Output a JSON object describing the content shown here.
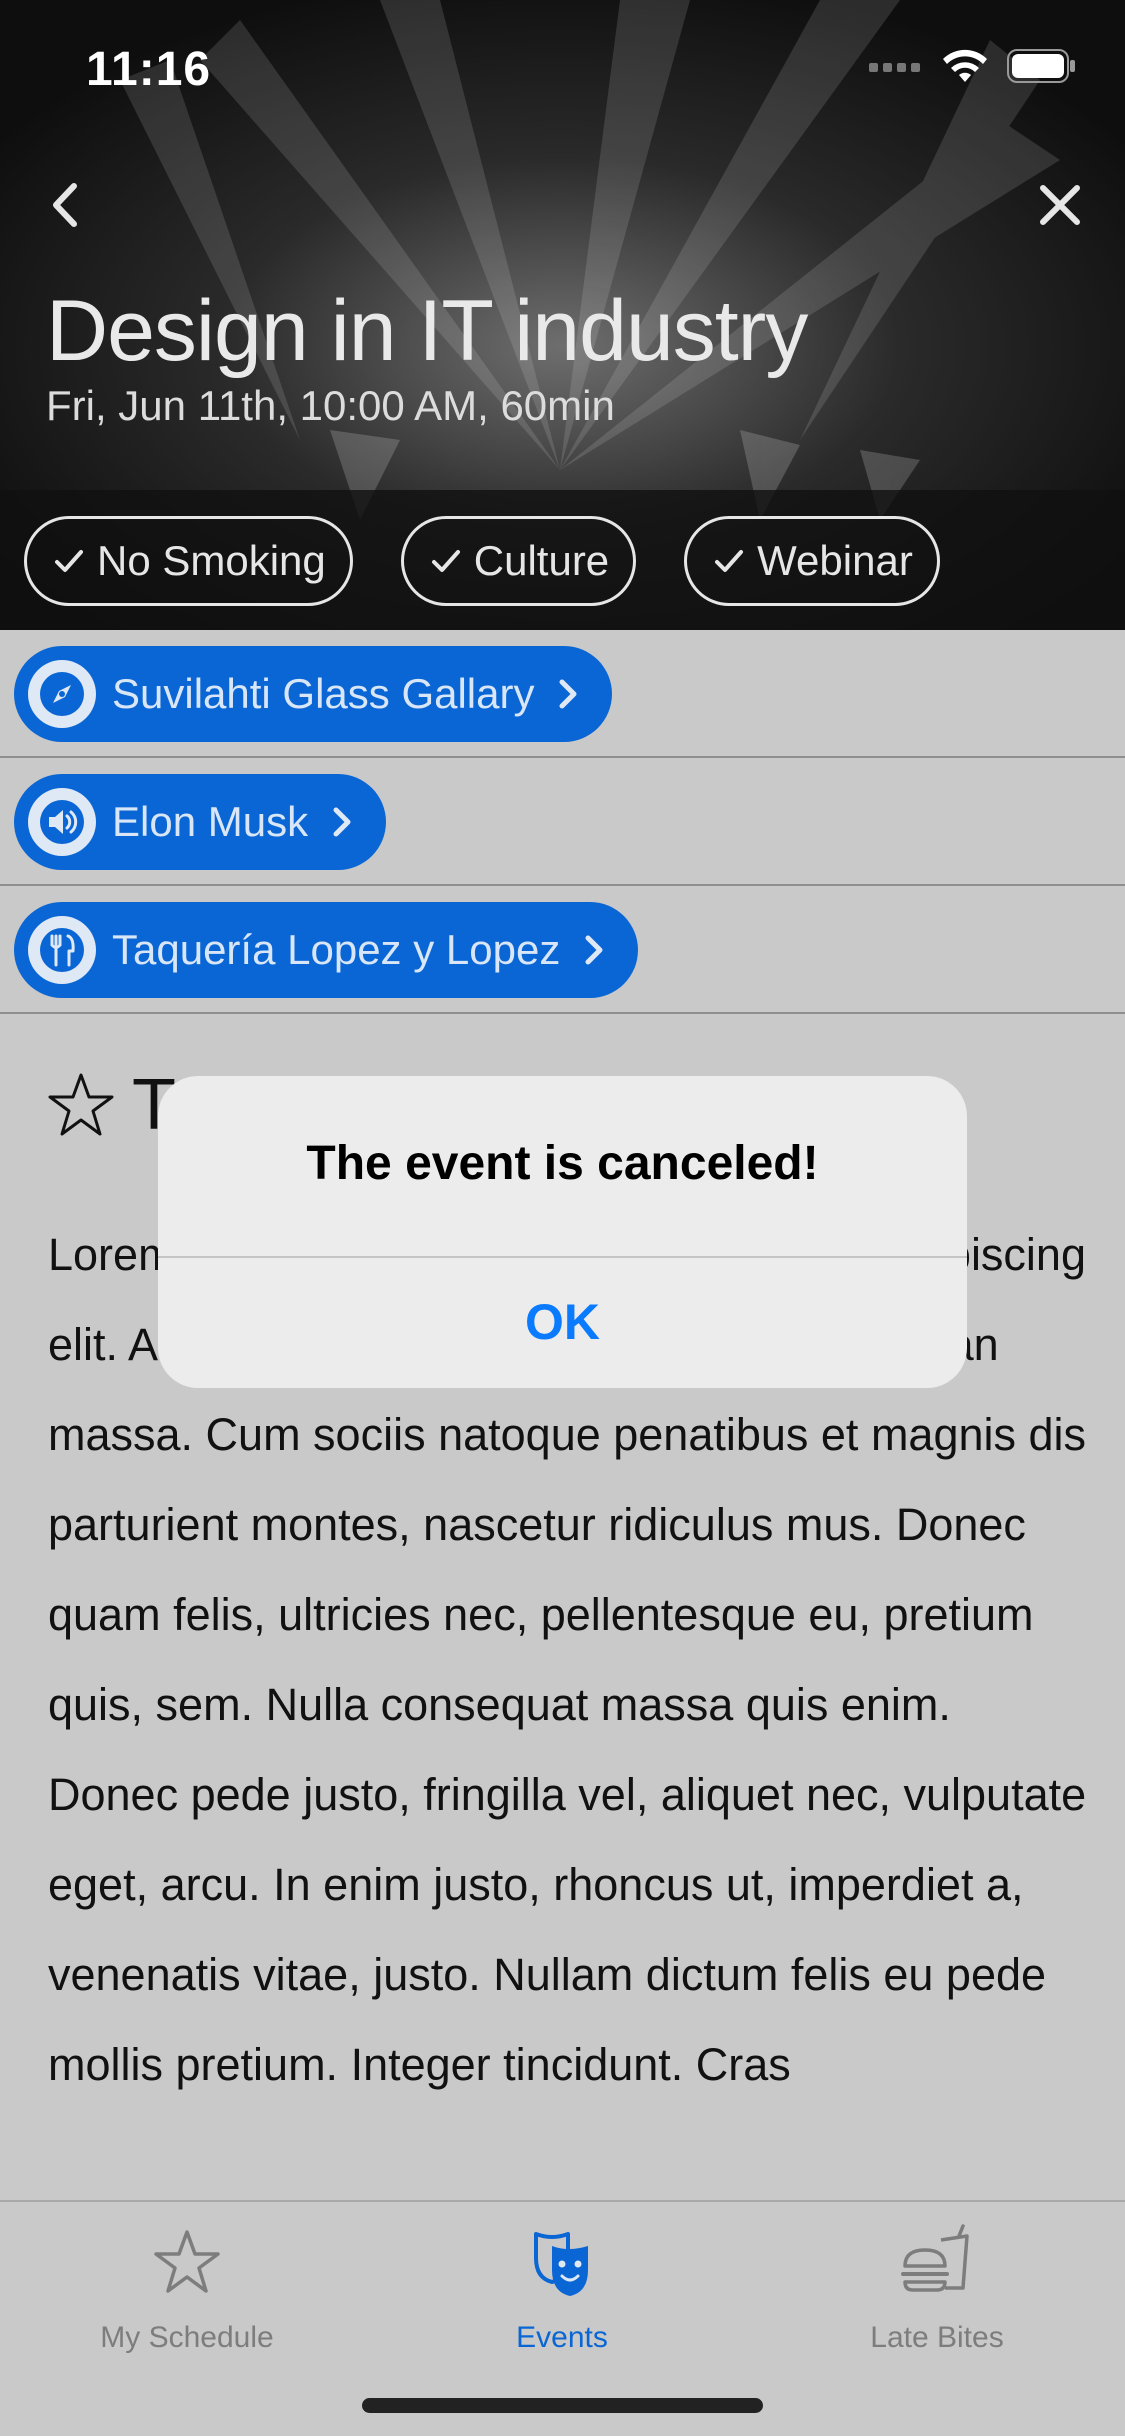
{
  "status_bar": {
    "time": "11:16"
  },
  "header": {
    "title": "Design in IT industry",
    "subtitle": "Fri, Jun 11th, 10:00 AM, 60min",
    "tags": [
      "No Smoking",
      "Culture",
      "Webinar"
    ]
  },
  "links": [
    {
      "label": "Suvilahti Glass Gallary",
      "icon": "compass-icon"
    },
    {
      "label": "Elon Musk",
      "icon": "speaker-icon"
    },
    {
      "label": "Taquería Lopez y Lopez",
      "icon": "fork-knife-icon"
    }
  ],
  "content": {
    "title_partial": "T",
    "body": "Lorem ipsum dolor sit amet, consectetuer adipiscing elit. Aenean commodo ligula eget dolor. Aenean massa. Cum sociis natoque penatibus et magnis dis parturient montes, nascetur ridiculus mus. Donec quam felis, ultricies nec, pellentesque eu, pretium quis, sem. Nulla consequat massa quis enim. Donec pede justo, fringilla vel, aliquet nec, vulputate eget, arcu. In enim justo, rhoncus ut, imperdiet a, venenatis vitae, justo. Nullam dictum felis eu pede mollis pretium. Integer tincidunt. Cras"
  },
  "alert": {
    "title": "The event is canceled!",
    "button": "OK"
  },
  "tabbar": {
    "tabs": [
      {
        "label": "My Schedule",
        "icon": "star-icon",
        "active": false
      },
      {
        "label": "Events",
        "icon": "masks-icon",
        "active": true
      },
      {
        "label": "Late Bites",
        "icon": "burger-drink-icon",
        "active": false
      }
    ]
  },
  "colors": {
    "accent": "#0a66d4",
    "alert_button": "#0a7aff"
  }
}
